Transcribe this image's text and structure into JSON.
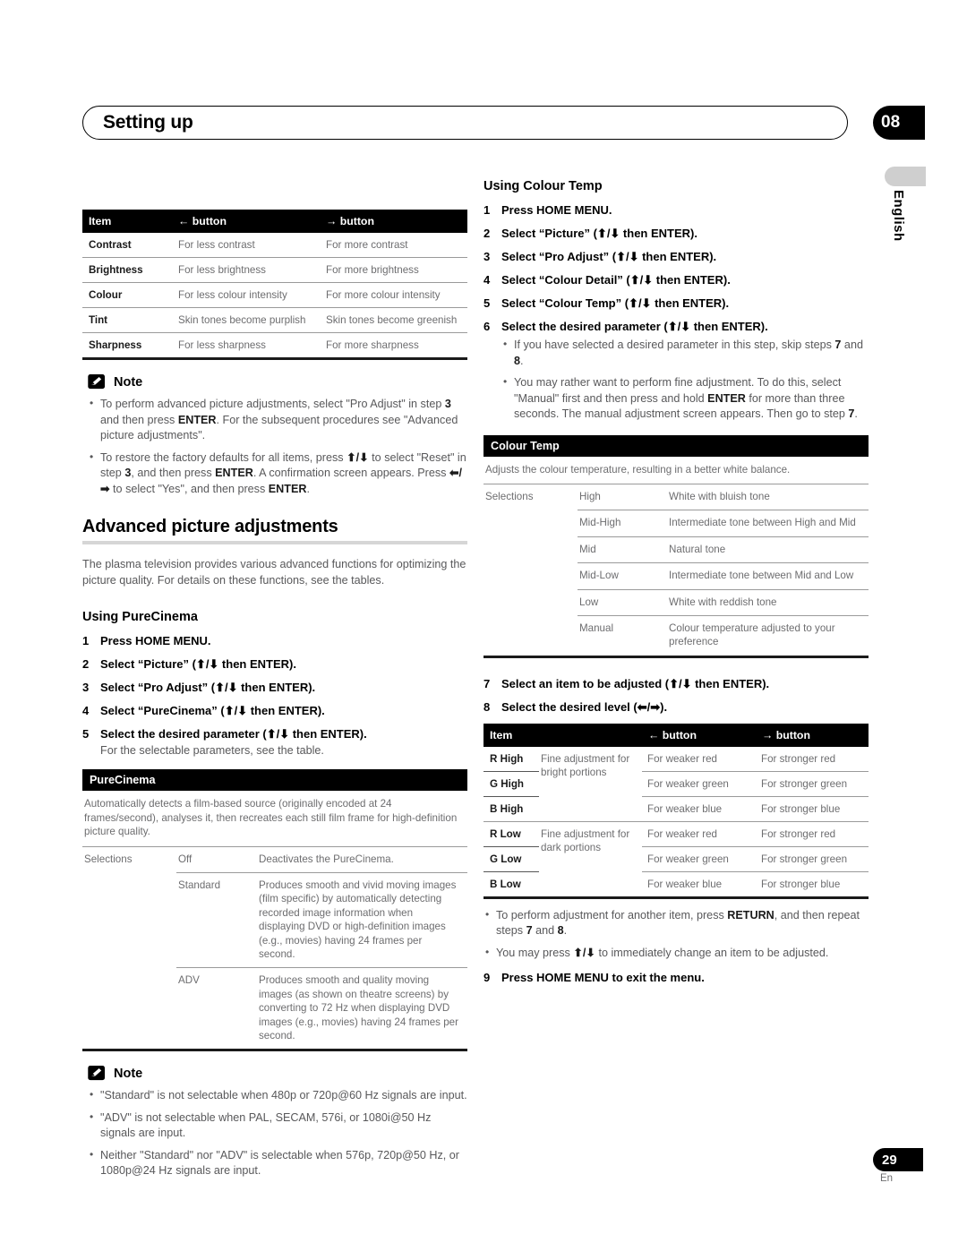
{
  "header": {
    "title": "Setting up",
    "chapter": "08",
    "language_tab": "English"
  },
  "footer": {
    "page_number": "29",
    "language_code": "En"
  },
  "left_column": {
    "picture_table": {
      "headers": [
        "Item",
        "← button",
        "→ button"
      ],
      "rows": [
        [
          "Contrast",
          "For less contrast",
          "For more contrast"
        ],
        [
          "Brightness",
          "For less brightness",
          "For more brightness"
        ],
        [
          "Colour",
          "For less colour intensity",
          "For more colour intensity"
        ],
        [
          "Tint",
          "Skin tones become purplish",
          "Skin tones become greenish"
        ],
        [
          "Sharpness",
          "For less sharpness",
          "For more sharpness"
        ]
      ]
    },
    "note_1": {
      "label": "Note",
      "bullets": [
        "To perform advanced picture adjustments, select \"Pro Adjust\" in step <b>3</b> and then press <b>ENTER</b>. For the subsequent procedures see \"Advanced picture adjustments\".",
        "To restore the factory defaults for all items, press <b>⬆/⬇</b> to select \"Reset\" in step <b>3</b>, and then press <b>ENTER</b>. A confirmation screen appears. Press <b>⬅/➡</b> to select \"Yes\", and then press <b>ENTER</b>."
      ]
    },
    "advanced_section": {
      "title": "Advanced picture adjustments",
      "intro": "The plasma television provides various advanced functions for optimizing the picture quality. For details on these functions, see the tables."
    },
    "purecinema_section": {
      "title": "Using PureCinema",
      "steps": [
        {
          "num": "1",
          "text": "Press HOME MENU."
        },
        {
          "num": "2",
          "text": "Select “Picture” (⬆/⬇ then ENTER)."
        },
        {
          "num": "3",
          "text": "Select “Pro Adjust” (⬆/⬇ then ENTER)."
        },
        {
          "num": "4",
          "text": "Select “PureCinema” (⬆/⬇ then ENTER)."
        },
        {
          "num": "5",
          "text": "Select the desired parameter (⬆/⬇ then ENTER)."
        }
      ],
      "step5_follow": "For the selectable parameters, see the table."
    },
    "purecinema_table": {
      "title": "PureCinema",
      "intro": "Automatically detects a film-based source (originally encoded at 24 frames/second), analyses it, then recreates each still film frame for high-definition picture quality.",
      "selections_label": "Selections",
      "rows": [
        [
          "Off",
          "Deactivates the PureCinema."
        ],
        [
          "Standard",
          "Produces smooth and vivid moving images (film specific) by automatically detecting recorded image information when displaying DVD or high-definition images (e.g., movies) having 24 frames per second."
        ],
        [
          "ADV",
          "Produces smooth and quality moving images (as shown on theatre screens) by converting to 72 Hz when displaying DVD images (e.g., movies) having 24 frames per second."
        ]
      ]
    },
    "note_2": {
      "label": "Note",
      "bullets": [
        "\"Standard\" is not selectable when 480p or 720p@60 Hz signals are input.",
        "\"ADV\" is not selectable when PAL, SECAM, 576i, or 1080i@50 Hz signals are input.",
        "Neither \"Standard\" nor \"ADV\" is selectable when 576p, 720p@50 Hz, or 1080p@24 Hz signals are input."
      ]
    }
  },
  "right_column": {
    "colour_temp_section": {
      "title": "Using Colour Temp",
      "steps": [
        {
          "num": "1",
          "text": "Press HOME MENU."
        },
        {
          "num": "2",
          "text": "Select “Picture” (⬆/⬇ then ENTER)."
        },
        {
          "num": "3",
          "text": "Select “Pro Adjust” (⬆/⬇ then ENTER)."
        },
        {
          "num": "4",
          "text": "Select “Colour Detail” (⬆/⬇ then ENTER)."
        },
        {
          "num": "5",
          "text": "Select “Colour Temp” (⬆/⬇ then ENTER)."
        },
        {
          "num": "6",
          "text": "Select the desired parameter (⬆/⬇ then ENTER)."
        }
      ],
      "step6_bullets": [
        "If you have selected a desired parameter in this step, skip steps <b>7</b> and <b>8</b>.",
        "You may rather want to perform fine adjustment. To do this, select \"Manual\" first and then press and hold <b>ENTER</b> for more than three seconds. The manual adjustment screen appears. Then go to step <b>7</b>."
      ]
    },
    "colour_temp_table": {
      "title": "Colour Temp",
      "intro": "Adjusts the colour temperature, resulting in a better white balance.",
      "selections_label": "Selections",
      "rows": [
        [
          "High",
          "White with bluish tone"
        ],
        [
          "Mid-High",
          "Intermediate tone between High and Mid"
        ],
        [
          "Mid",
          "Natural tone"
        ],
        [
          "Mid-Low",
          "Intermediate tone between Mid and Low"
        ],
        [
          "Low",
          "White with reddish tone"
        ],
        [
          "Manual",
          "Colour temperature adjusted to your preference"
        ]
      ]
    },
    "steps_78": [
      {
        "num": "7",
        "text": "Select an item to be adjusted (⬆/⬇ then ENTER)."
      },
      {
        "num": "8",
        "text": "Select the desired level (⬅/➡)."
      }
    ],
    "rgb_table": {
      "headers": [
        "Item",
        "",
        "← button",
        "→ button"
      ],
      "groups": [
        {
          "fine_label": "Fine adjustment for bright portions",
          "rows": [
            [
              "R High",
              "For weaker red",
              "For stronger red"
            ],
            [
              "G High",
              "For weaker green",
              "For stronger green"
            ],
            [
              "B High",
              "For weaker blue",
              "For stronger blue"
            ]
          ]
        },
        {
          "fine_label": "Fine adjustment for dark portions",
          "rows": [
            [
              "R Low",
              "For weaker red",
              "For stronger red"
            ],
            [
              "G Low",
              "For weaker green",
              "For stronger green"
            ],
            [
              "B Low",
              "For weaker blue",
              "For stronger blue"
            ]
          ]
        }
      ]
    },
    "final_bullets": [
      "To perform adjustment for another item, press <b>RETURN</b>, and then repeat steps <b>7</b> and <b>8</b>.",
      "You may press <b>⬆/⬇</b> to immediately change an item to be adjusted."
    ],
    "step_9": {
      "num": "9",
      "text": "Press HOME MENU to exit the menu."
    }
  }
}
